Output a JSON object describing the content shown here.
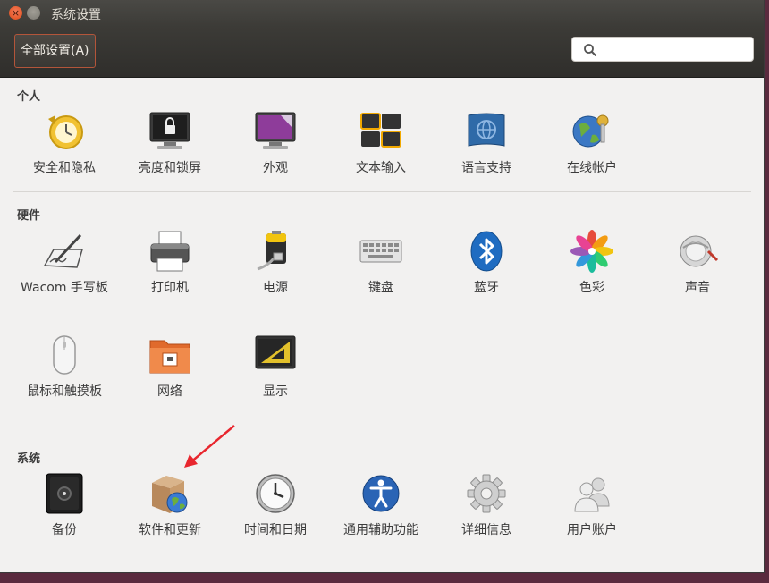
{
  "window": {
    "title": "系统设置",
    "close_glyph": "×",
    "min_glyph": "−"
  },
  "toolbar": {
    "all_settings_label": "全部设置(A)",
    "search_placeholder": ""
  },
  "sections": [
    {
      "title": "个人",
      "items": [
        {
          "label": "安全和隐私",
          "icon": "security-privacy-icon"
        },
        {
          "label": "亮度和锁屏",
          "icon": "brightness-lock-icon"
        },
        {
          "label": "外观",
          "icon": "appearance-icon"
        },
        {
          "label": "文本输入",
          "icon": "text-entry-icon"
        },
        {
          "label": "语言支持",
          "icon": "language-support-icon"
        },
        {
          "label": "在线帐户",
          "icon": "online-accounts-icon"
        }
      ]
    },
    {
      "title": "硬件",
      "items": [
        {
          "label": "Wacom 手写板",
          "icon": "wacom-tablet-icon"
        },
        {
          "label": "打印机",
          "icon": "printer-icon"
        },
        {
          "label": "电源",
          "icon": "power-icon"
        },
        {
          "label": "键盘",
          "icon": "keyboard-icon"
        },
        {
          "label": "蓝牙",
          "icon": "bluetooth-icon"
        },
        {
          "label": "色彩",
          "icon": "color-icon"
        },
        {
          "label": "声音",
          "icon": "sound-icon"
        },
        {
          "label": "鼠标和触摸板",
          "icon": "mouse-touchpad-icon"
        },
        {
          "label": "网络",
          "icon": "network-icon"
        },
        {
          "label": "显示",
          "icon": "display-icon"
        }
      ]
    },
    {
      "title": "系统",
      "items": [
        {
          "label": "备份",
          "icon": "backup-icon"
        },
        {
          "label": "软件和更新",
          "icon": "software-updates-icon"
        },
        {
          "label": "时间和日期",
          "icon": "time-date-icon"
        },
        {
          "label": "通用辅助功能",
          "icon": "universal-access-icon"
        },
        {
          "label": "详细信息",
          "icon": "details-icon"
        },
        {
          "label": "用户账户",
          "icon": "user-accounts-icon"
        }
      ]
    }
  ],
  "colors": {
    "accent": "#e95420",
    "toolbar_bg": "#3c3b37",
    "window_bg": "#f2f1f0",
    "annotation_arrow": "#e8262e"
  }
}
